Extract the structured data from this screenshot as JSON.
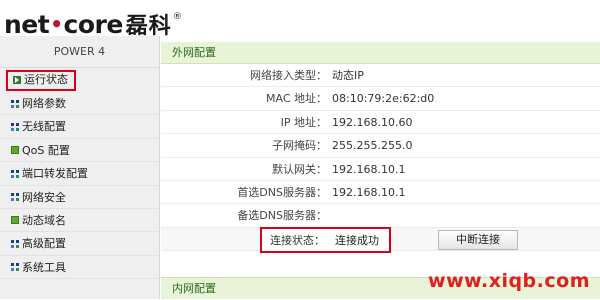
{
  "header": {
    "brand": "net",
    "brand2": "core",
    "brand_cn": "磊科",
    "reg": "®"
  },
  "sidebar": {
    "model": "POWER 4",
    "items": [
      {
        "label": "运行状态",
        "icon": "play-icon"
      },
      {
        "label": "网络参数",
        "icon": "grid-icon"
      },
      {
        "label": "无线配置",
        "icon": "grid-icon"
      },
      {
        "label": "QoS 配置",
        "icon": "green-square-icon"
      },
      {
        "label": "端口转发配置",
        "icon": "grid-icon"
      },
      {
        "label": "网络安全",
        "icon": "grid-icon"
      },
      {
        "label": "动态域名",
        "icon": "green-square-icon"
      },
      {
        "label": "高级配置",
        "icon": "grid-icon"
      },
      {
        "label": "系统工具",
        "icon": "grid-icon"
      }
    ]
  },
  "wan": {
    "title": "外网配置",
    "rows": [
      {
        "label": "网络接入类型：",
        "value": "动态IP"
      },
      {
        "label": "MAC 地址：",
        "value": "08:10:79:2e:62:d0"
      },
      {
        "label": "IP 地址：",
        "value": "192.168.10.60"
      },
      {
        "label": "子网掩码：",
        "value": "255.255.255.0"
      },
      {
        "label": "默认网关：",
        "value": "192.168.10.1"
      },
      {
        "label": "首选DNS服务器：",
        "value": "192.168.10.1"
      },
      {
        "label": "备选DNS服务器：",
        "value": ""
      }
    ],
    "status_label": "连接状态：",
    "status_value": "连接成功",
    "disconnect_button": "中断连接"
  },
  "lan": {
    "title": "内网配置"
  },
  "watermark": "www.xiqb.com",
  "colors": {
    "highlight": "#d9001b",
    "section_bg": "#e8f3d8",
    "section_text": "#2b6b1e"
  }
}
